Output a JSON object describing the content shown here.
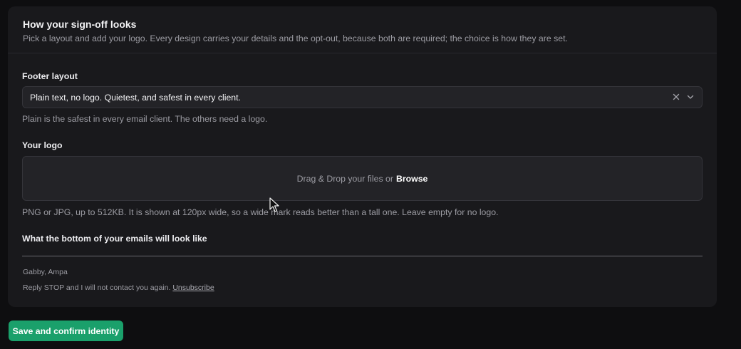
{
  "card": {
    "title": "How your sign-off looks",
    "subtitle": "Pick a layout and add your logo. Every design carries your details and the opt-out, because both are required; the choice is how they are set."
  },
  "footer_layout": {
    "label": "Footer layout",
    "selected_value": "Plain text, no logo. Quietest, and safest in every client.",
    "help": "Plain is the safest in every email client. The others need a logo.",
    "clear_icon": "close-icon",
    "dropdown_icon": "chevron-down-icon"
  },
  "logo": {
    "label": "Your logo",
    "dropzone_text": "Drag & Drop your files or",
    "browse_label": "Browse",
    "help": "PNG or JPG, up to 512KB. It is shown at 120px wide, so a wide mark reads better than a tall one. Leave empty for no logo."
  },
  "preview": {
    "label": "What the bottom of your emails will look like",
    "signature_name": "Gabby, Ampa",
    "optout_text": "Reply STOP and I will not contact you again.",
    "unsubscribe_label": "Unsubscribe"
  },
  "actions": {
    "save_label": "Save and confirm identity"
  },
  "colors": {
    "background": "#0e0e10",
    "card": "#19191c",
    "input": "#232327",
    "accent": "#1aa06b"
  }
}
